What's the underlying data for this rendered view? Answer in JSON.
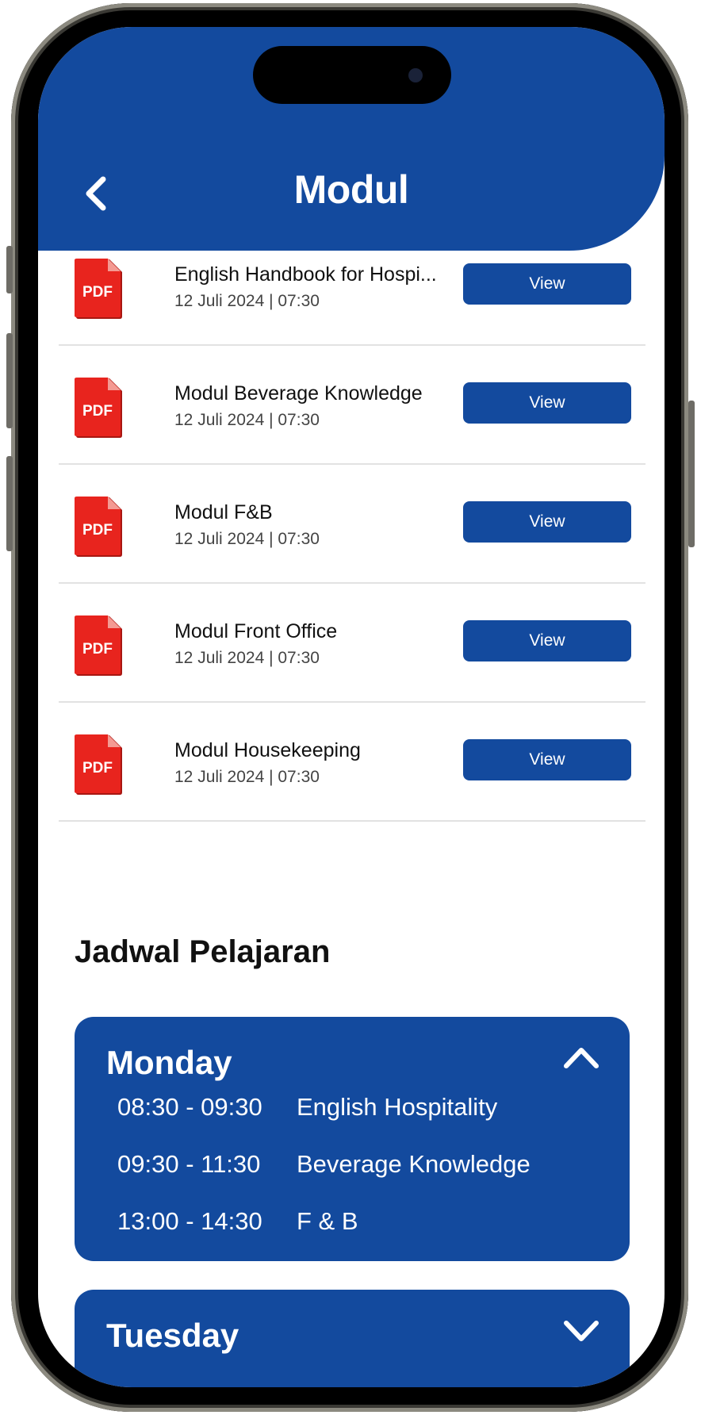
{
  "header": {
    "title": "Modul",
    "back_icon": "chevron-left-icon"
  },
  "modules": [
    {
      "name": "English Handbook for Hospi...",
      "date": "12 Juli 2024 | 07:30",
      "action": "View",
      "icon_text": "PDF"
    },
    {
      "name": "Modul Beverage Knowledge",
      "date": "12 Juli 2024 | 07:30",
      "action": "View",
      "icon_text": "PDF"
    },
    {
      "name": "Modul F&B",
      "date": "12 Juli 2024 | 07:30",
      "action": "View",
      "icon_text": "PDF"
    },
    {
      "name": "Modul Front Office",
      "date": "12 Juli 2024 | 07:30",
      "action": "View",
      "icon_text": "PDF"
    },
    {
      "name": "Modul Housekeeping",
      "date": "12 Juli 2024 | 07:30",
      "action": "View",
      "icon_text": "PDF"
    }
  ],
  "schedule": {
    "title": "Jadwal Pelajaran",
    "days": [
      {
        "day": "Monday",
        "expanded": true,
        "toggle_icon": "chevron-up-icon",
        "slots": [
          {
            "time": "08:30 - 09:30",
            "subject": "English Hospitality"
          },
          {
            "time": "09:30 - 11:30",
            "subject": "Beverage Knowledge"
          },
          {
            "time": "13:00 - 14:30",
            "subject": "F & B"
          }
        ]
      },
      {
        "day": "Tuesday",
        "expanded": false,
        "toggle_icon": "chevron-down-icon",
        "slots": []
      }
    ]
  },
  "colors": {
    "primary": "#134a9e",
    "pdf_red": "#e8241e",
    "divider": "#e2e2e2"
  }
}
